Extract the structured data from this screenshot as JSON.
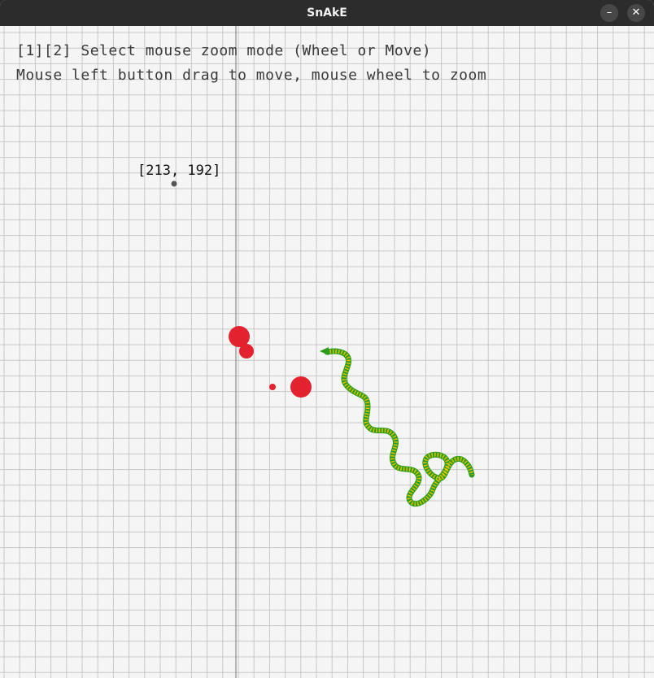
{
  "window": {
    "title": "SnAkE",
    "minimize_glyph": "–",
    "close_glyph": "✕"
  },
  "hud": {
    "line1": "[1][2] Select mouse zoom mode (Wheel or Move)",
    "line2": "Mouse left button drag to move, mouse wheel to zoom"
  },
  "cursor_readout": "[213, 192]",
  "colors": {
    "background": "#f5f5f5",
    "grid": "#c8c8c8",
    "axis": "#8a8a8a",
    "food": "#e3212f",
    "snake_body": "#2e9b1e",
    "snake_stripe": "#d6c400",
    "titlebar": "#2c2c2c"
  },
  "icons": {
    "minimize": "minimize-icon",
    "close": "close-icon"
  }
}
